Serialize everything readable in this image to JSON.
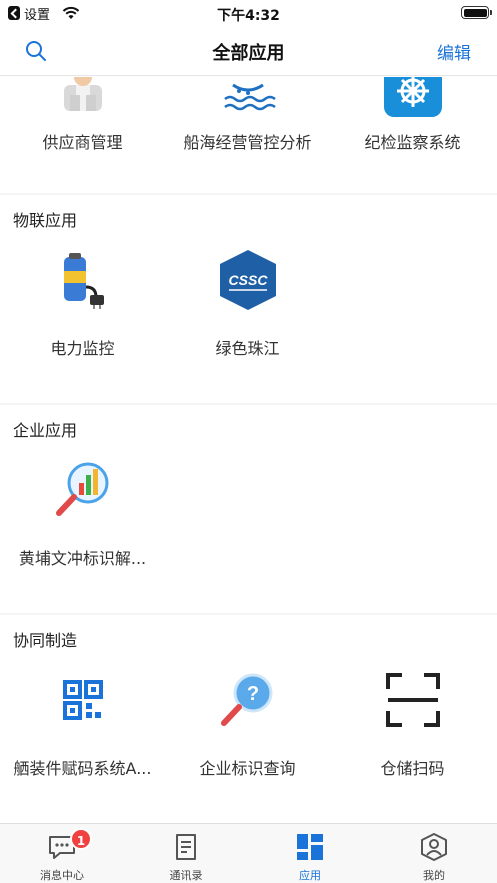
{
  "status_bar": {
    "back_label": "设置",
    "time": "下午4:32"
  },
  "nav": {
    "title": "全部应用",
    "edit_label": "编辑"
  },
  "sections": [
    {
      "title": "",
      "apps": [
        {
          "label": "供应商管理",
          "icon": "supplier-person-icon"
        },
        {
          "label": "船海经营管控分析",
          "icon": "ship-waves-icon"
        },
        {
          "label": "纪检监察系统",
          "icon": "helm-wheel-icon"
        }
      ]
    },
    {
      "title": "物联应用",
      "apps": [
        {
          "label": "电力监控",
          "icon": "battery-plug-icon"
        },
        {
          "label": "绿色珠江",
          "icon": "cssc-logo-icon"
        }
      ]
    },
    {
      "title": "企业应用",
      "apps": [
        {
          "label": "黄埔文冲标识解...",
          "icon": "magnifier-chart-icon"
        }
      ]
    },
    {
      "title": "协同制造",
      "apps": [
        {
          "label": "舾装件赋码系统A...",
          "icon": "qr-code-icon"
        },
        {
          "label": "企业标识查询",
          "icon": "magnifier-question-icon"
        },
        {
          "label": "仓储扫码",
          "icon": "scan-frame-icon"
        }
      ]
    }
  ],
  "tabs": [
    {
      "label": "消息中心",
      "icon": "message-icon",
      "badge": "1"
    },
    {
      "label": "通讯录",
      "icon": "contacts-book-icon"
    },
    {
      "label": "应用",
      "icon": "apps-grid-icon",
      "active": true
    },
    {
      "label": "我的",
      "icon": "profile-icon"
    }
  ],
  "colors": {
    "accent": "#1a73d9",
    "badge": "#f04040",
    "cssc_blue": "#1f5fa6"
  }
}
